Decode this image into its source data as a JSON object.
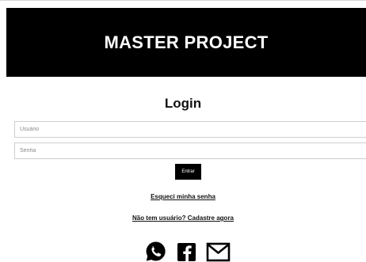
{
  "header": {
    "title": "MASTER PROJECT"
  },
  "login": {
    "heading": "Login",
    "username_placeholder": "Usuário",
    "password_placeholder": "Senha",
    "submit_label": "Entrar",
    "forgot_link": "Esqueci minha senha",
    "register_link": "Não tem usuário? Cadastre agora"
  },
  "social": {
    "icons": [
      "whatsapp-icon",
      "facebook-icon",
      "mail-icon"
    ]
  },
  "colors": {
    "banner": "#000000",
    "banner_text": "#ffffff",
    "button": "#000000"
  }
}
